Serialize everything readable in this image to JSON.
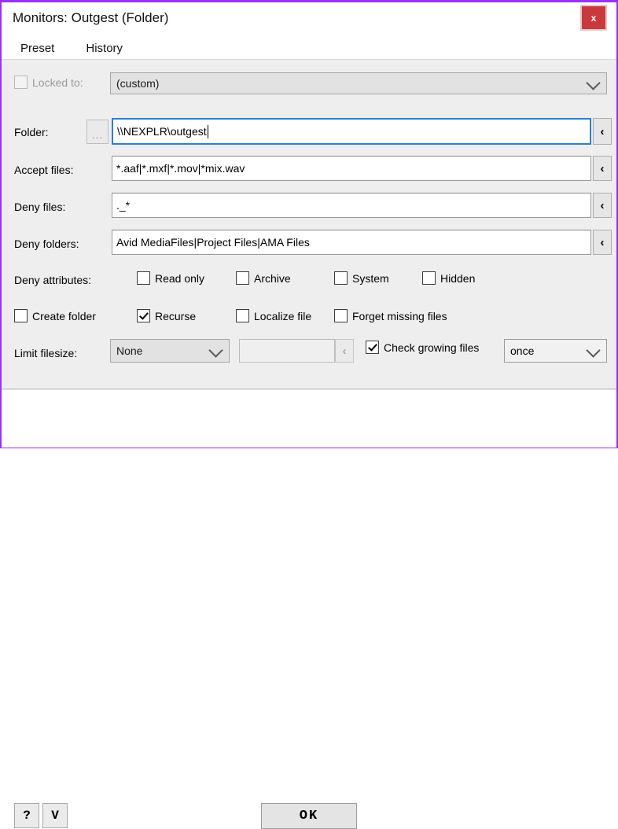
{
  "window": {
    "title": "Monitors: Outgest (Folder)",
    "close_label": "x",
    "accent_border": "#9b30ff",
    "close_color": "#c9393c"
  },
  "menubar": {
    "items": [
      {
        "label": "Preset"
      },
      {
        "label": "History"
      }
    ]
  },
  "form": {
    "locked_to": {
      "label": "Locked to:",
      "checked": false,
      "enabled": false,
      "value": "(custom)"
    },
    "folder": {
      "label": "Folder:",
      "browse_label": "...",
      "value": "\\\\NEXPLR\\outgest",
      "recall_label": "‹"
    },
    "accept_files": {
      "label": "Accept files:",
      "value": "*.aaf|*.mxf|*.mov|*mix.wav",
      "recall_label": "‹"
    },
    "deny_files": {
      "label": "Deny files:",
      "value": "._*",
      "recall_label": "‹"
    },
    "deny_folders": {
      "label": "Deny folders:",
      "value": "Avid MediaFiles|Project Files|AMA Files",
      "recall_label": "‹"
    },
    "deny_attributes": {
      "label": "Deny attributes:",
      "options": [
        {
          "label": "Read only",
          "checked": false
        },
        {
          "label": "Archive",
          "checked": false
        },
        {
          "label": "System",
          "checked": false
        },
        {
          "label": "Hidden",
          "checked": false
        }
      ]
    },
    "flags": [
      {
        "label": "Create folder",
        "checked": false
      },
      {
        "label": "Recurse",
        "checked": true
      },
      {
        "label": "Localize file",
        "checked": false
      },
      {
        "label": "Forget missing files",
        "checked": false
      }
    ],
    "limit_filesize": {
      "label": "Limit filesize:",
      "value": "None",
      "size_value": "",
      "recall_label": "‹"
    },
    "check_growing": {
      "label": "Check growing files",
      "checked": true,
      "value": "once"
    }
  },
  "footer": {
    "help_label": "?",
    "version_label": "V",
    "ok_label": "OK"
  }
}
